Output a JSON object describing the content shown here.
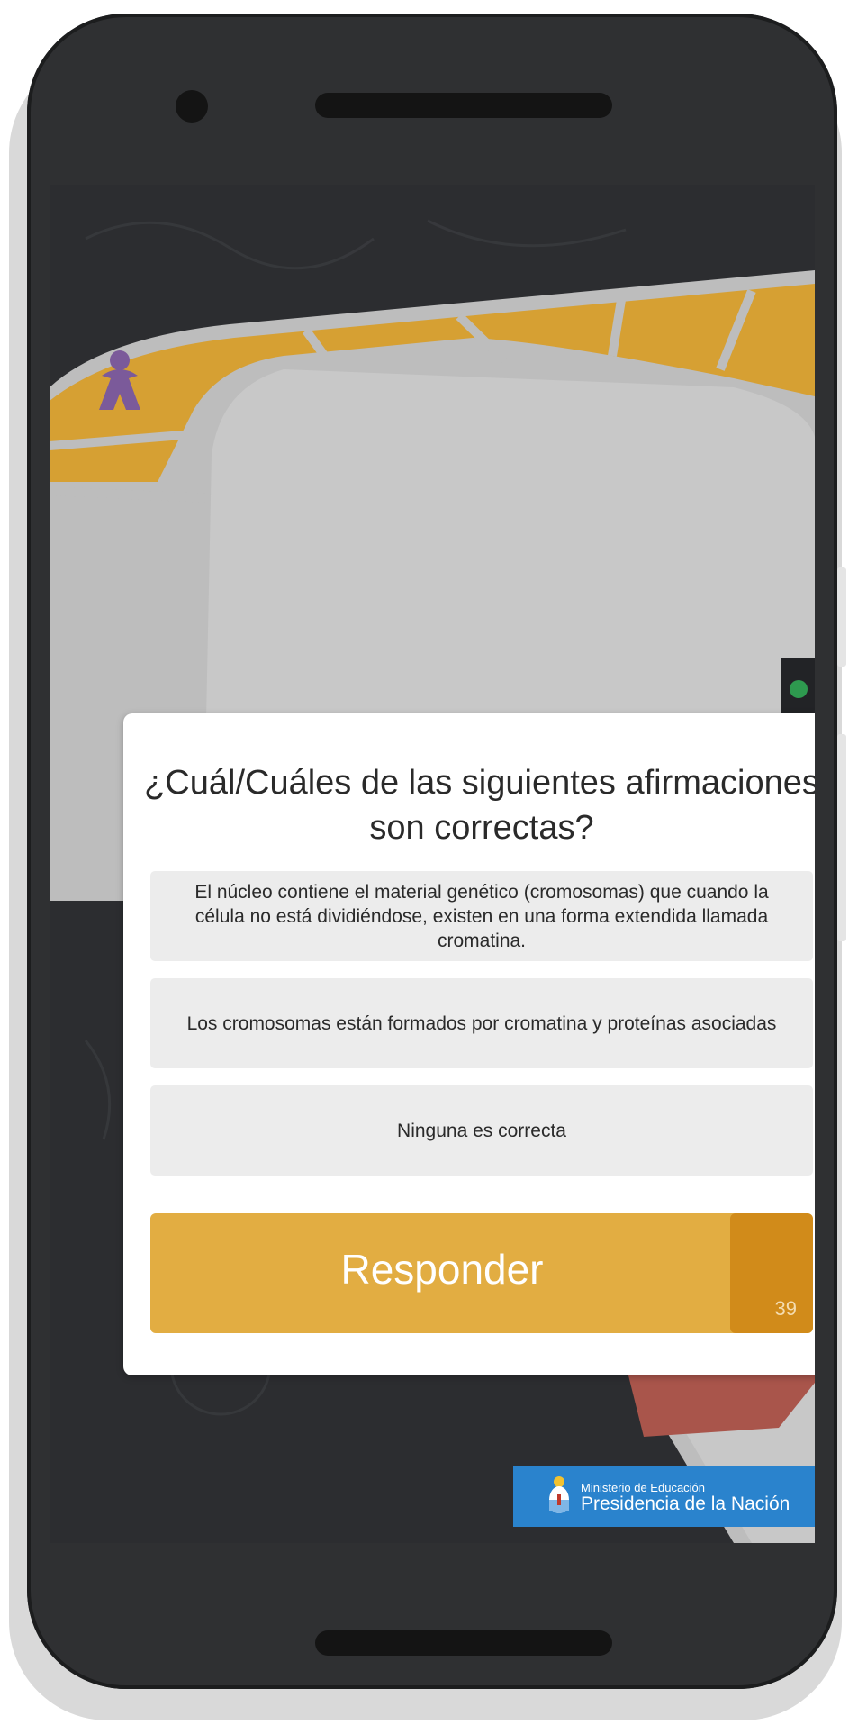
{
  "dialog": {
    "question": "¿Cuál/Cuáles de las siguientes afirmaciones son correctas?",
    "options": [
      "El núcleo contiene el material genético (cromosomas) que cuando la célula no está dividiéndose, existen en una forma extendida llamada cromatina.",
      "Los cromosomas están formados por cromatina y proteínas asociadas",
      "Ninguna es correcta"
    ],
    "submit_label": "Responder",
    "timer": "39"
  },
  "footer": {
    "ministry_line1": "Ministerio de Educación",
    "ministry_line2": "Presidencia de la Nación"
  },
  "colors": {
    "board_track": "#d6a033",
    "board_inner": "#c8c8c8",
    "board_red": "#a9554b",
    "button": "#e2ad42",
    "timer": "#d18b1a",
    "ministry_blue": "#2a83cd",
    "player_piece": "#7b5a9a"
  },
  "icons": {
    "player_piece": "meeple-icon",
    "emblem": "coat-of-arms-icon"
  }
}
